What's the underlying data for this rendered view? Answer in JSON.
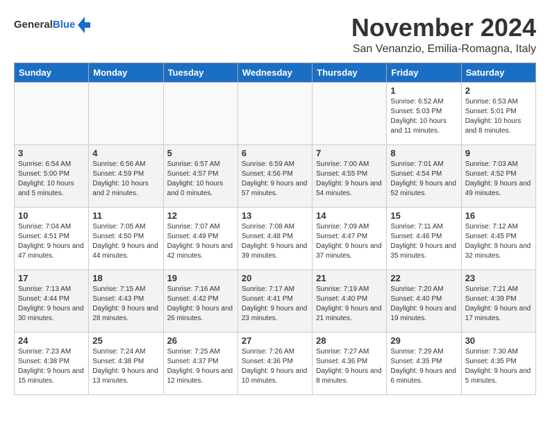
{
  "header": {
    "logo_general": "General",
    "logo_blue": "Blue",
    "month_year": "November 2024",
    "location": "San Venanzio, Emilia-Romagna, Italy"
  },
  "weekdays": [
    "Sunday",
    "Monday",
    "Tuesday",
    "Wednesday",
    "Thursday",
    "Friday",
    "Saturday"
  ],
  "weeks": [
    [
      {
        "day": "",
        "info": ""
      },
      {
        "day": "",
        "info": ""
      },
      {
        "day": "",
        "info": ""
      },
      {
        "day": "",
        "info": ""
      },
      {
        "day": "",
        "info": ""
      },
      {
        "day": "1",
        "info": "Sunrise: 6:52 AM\nSunset: 5:03 PM\nDaylight: 10 hours and 11 minutes."
      },
      {
        "day": "2",
        "info": "Sunrise: 6:53 AM\nSunset: 5:01 PM\nDaylight: 10 hours and 8 minutes."
      }
    ],
    [
      {
        "day": "3",
        "info": "Sunrise: 6:54 AM\nSunset: 5:00 PM\nDaylight: 10 hours and 5 minutes."
      },
      {
        "day": "4",
        "info": "Sunrise: 6:56 AM\nSunset: 4:59 PM\nDaylight: 10 hours and 2 minutes."
      },
      {
        "day": "5",
        "info": "Sunrise: 6:57 AM\nSunset: 4:57 PM\nDaylight: 10 hours and 0 minutes."
      },
      {
        "day": "6",
        "info": "Sunrise: 6:59 AM\nSunset: 4:56 PM\nDaylight: 9 hours and 57 minutes."
      },
      {
        "day": "7",
        "info": "Sunrise: 7:00 AM\nSunset: 4:55 PM\nDaylight: 9 hours and 54 minutes."
      },
      {
        "day": "8",
        "info": "Sunrise: 7:01 AM\nSunset: 4:54 PM\nDaylight: 9 hours and 52 minutes."
      },
      {
        "day": "9",
        "info": "Sunrise: 7:03 AM\nSunset: 4:52 PM\nDaylight: 9 hours and 49 minutes."
      }
    ],
    [
      {
        "day": "10",
        "info": "Sunrise: 7:04 AM\nSunset: 4:51 PM\nDaylight: 9 hours and 47 minutes."
      },
      {
        "day": "11",
        "info": "Sunrise: 7:05 AM\nSunset: 4:50 PM\nDaylight: 9 hours and 44 minutes."
      },
      {
        "day": "12",
        "info": "Sunrise: 7:07 AM\nSunset: 4:49 PM\nDaylight: 9 hours and 42 minutes."
      },
      {
        "day": "13",
        "info": "Sunrise: 7:08 AM\nSunset: 4:48 PM\nDaylight: 9 hours and 39 minutes."
      },
      {
        "day": "14",
        "info": "Sunrise: 7:09 AM\nSunset: 4:47 PM\nDaylight: 9 hours and 37 minutes."
      },
      {
        "day": "15",
        "info": "Sunrise: 7:11 AM\nSunset: 4:46 PM\nDaylight: 9 hours and 35 minutes."
      },
      {
        "day": "16",
        "info": "Sunrise: 7:12 AM\nSunset: 4:45 PM\nDaylight: 9 hours and 32 minutes."
      }
    ],
    [
      {
        "day": "17",
        "info": "Sunrise: 7:13 AM\nSunset: 4:44 PM\nDaylight: 9 hours and 30 minutes."
      },
      {
        "day": "18",
        "info": "Sunrise: 7:15 AM\nSunset: 4:43 PM\nDaylight: 9 hours and 28 minutes."
      },
      {
        "day": "19",
        "info": "Sunrise: 7:16 AM\nSunset: 4:42 PM\nDaylight: 9 hours and 26 minutes."
      },
      {
        "day": "20",
        "info": "Sunrise: 7:17 AM\nSunset: 4:41 PM\nDaylight: 9 hours and 23 minutes."
      },
      {
        "day": "21",
        "info": "Sunrise: 7:19 AM\nSunset: 4:40 PM\nDaylight: 9 hours and 21 minutes."
      },
      {
        "day": "22",
        "info": "Sunrise: 7:20 AM\nSunset: 4:40 PM\nDaylight: 9 hours and 19 minutes."
      },
      {
        "day": "23",
        "info": "Sunrise: 7:21 AM\nSunset: 4:39 PM\nDaylight: 9 hours and 17 minutes."
      }
    ],
    [
      {
        "day": "24",
        "info": "Sunrise: 7:23 AM\nSunset: 4:38 PM\nDaylight: 9 hours and 15 minutes."
      },
      {
        "day": "25",
        "info": "Sunrise: 7:24 AM\nSunset: 4:38 PM\nDaylight: 9 hours and 13 minutes."
      },
      {
        "day": "26",
        "info": "Sunrise: 7:25 AM\nSunset: 4:37 PM\nDaylight: 9 hours and 12 minutes."
      },
      {
        "day": "27",
        "info": "Sunrise: 7:26 AM\nSunset: 4:36 PM\nDaylight: 9 hours and 10 minutes."
      },
      {
        "day": "28",
        "info": "Sunrise: 7:27 AM\nSunset: 4:36 PM\nDaylight: 9 hours and 8 minutes."
      },
      {
        "day": "29",
        "info": "Sunrise: 7:29 AM\nSunset: 4:35 PM\nDaylight: 9 hours and 6 minutes."
      },
      {
        "day": "30",
        "info": "Sunrise: 7:30 AM\nSunset: 4:35 PM\nDaylight: 9 hours and 5 minutes."
      }
    ]
  ]
}
